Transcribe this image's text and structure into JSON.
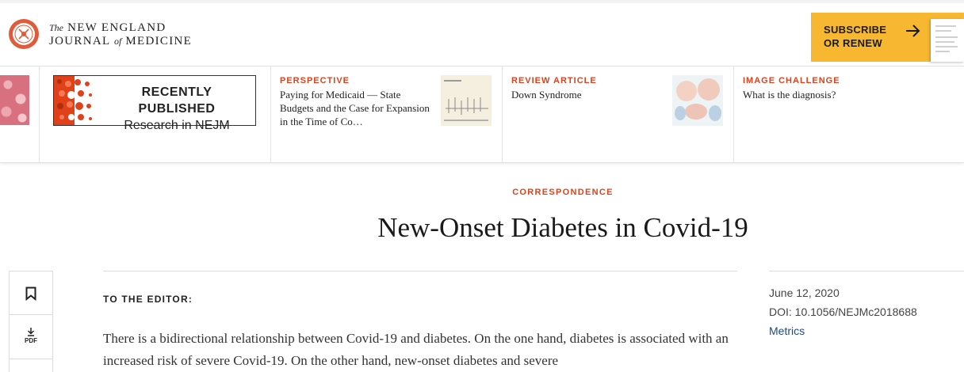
{
  "header": {
    "logo_line1_prefix": "The",
    "logo_line1": "NEW ENGLAND",
    "logo_line2_a": "JOURNAL",
    "logo_line2_of": "of",
    "logo_line2_b": "MEDICINE",
    "subscribe_line1": "SUBSCRIBE",
    "subscribe_line2": "OR RENEW"
  },
  "promo": {
    "recently_published_line1": "RECENTLY PUBLISHED",
    "recently_published_line2": "Research in NEJM",
    "cards": [
      {
        "kicker": "PERSPECTIVE",
        "title": "Paying for Medicaid — State Budgets and the Case for Expansion in the Time of Co…"
      },
      {
        "kicker": "REVIEW ARTICLE",
        "title": "Down Syndrome"
      },
      {
        "kicker": "IMAGE CHALLENGE",
        "title": "What is the diagnosis?"
      }
    ]
  },
  "article": {
    "kicker": "CORRESPONDENCE",
    "title": "New-Onset Diabetes in Covid-19",
    "section_label": "TO THE EDITOR:",
    "body": "There is a bidirectional relationship between Covid-19 and diabetes. On the one hand, diabetes is associated with an increased risk of severe Covid-19. On the other hand, new-onset diabetes and severe",
    "date": "June 12, 2020",
    "doi": "DOI: 10.1056/NEJMc2018688",
    "metrics": "Metrics"
  },
  "tools": {
    "pdf_label": "PDF"
  },
  "colors": {
    "accent": "#e0411b",
    "subscribe_bg": "#f7b731",
    "link": "#1a4b8c"
  }
}
